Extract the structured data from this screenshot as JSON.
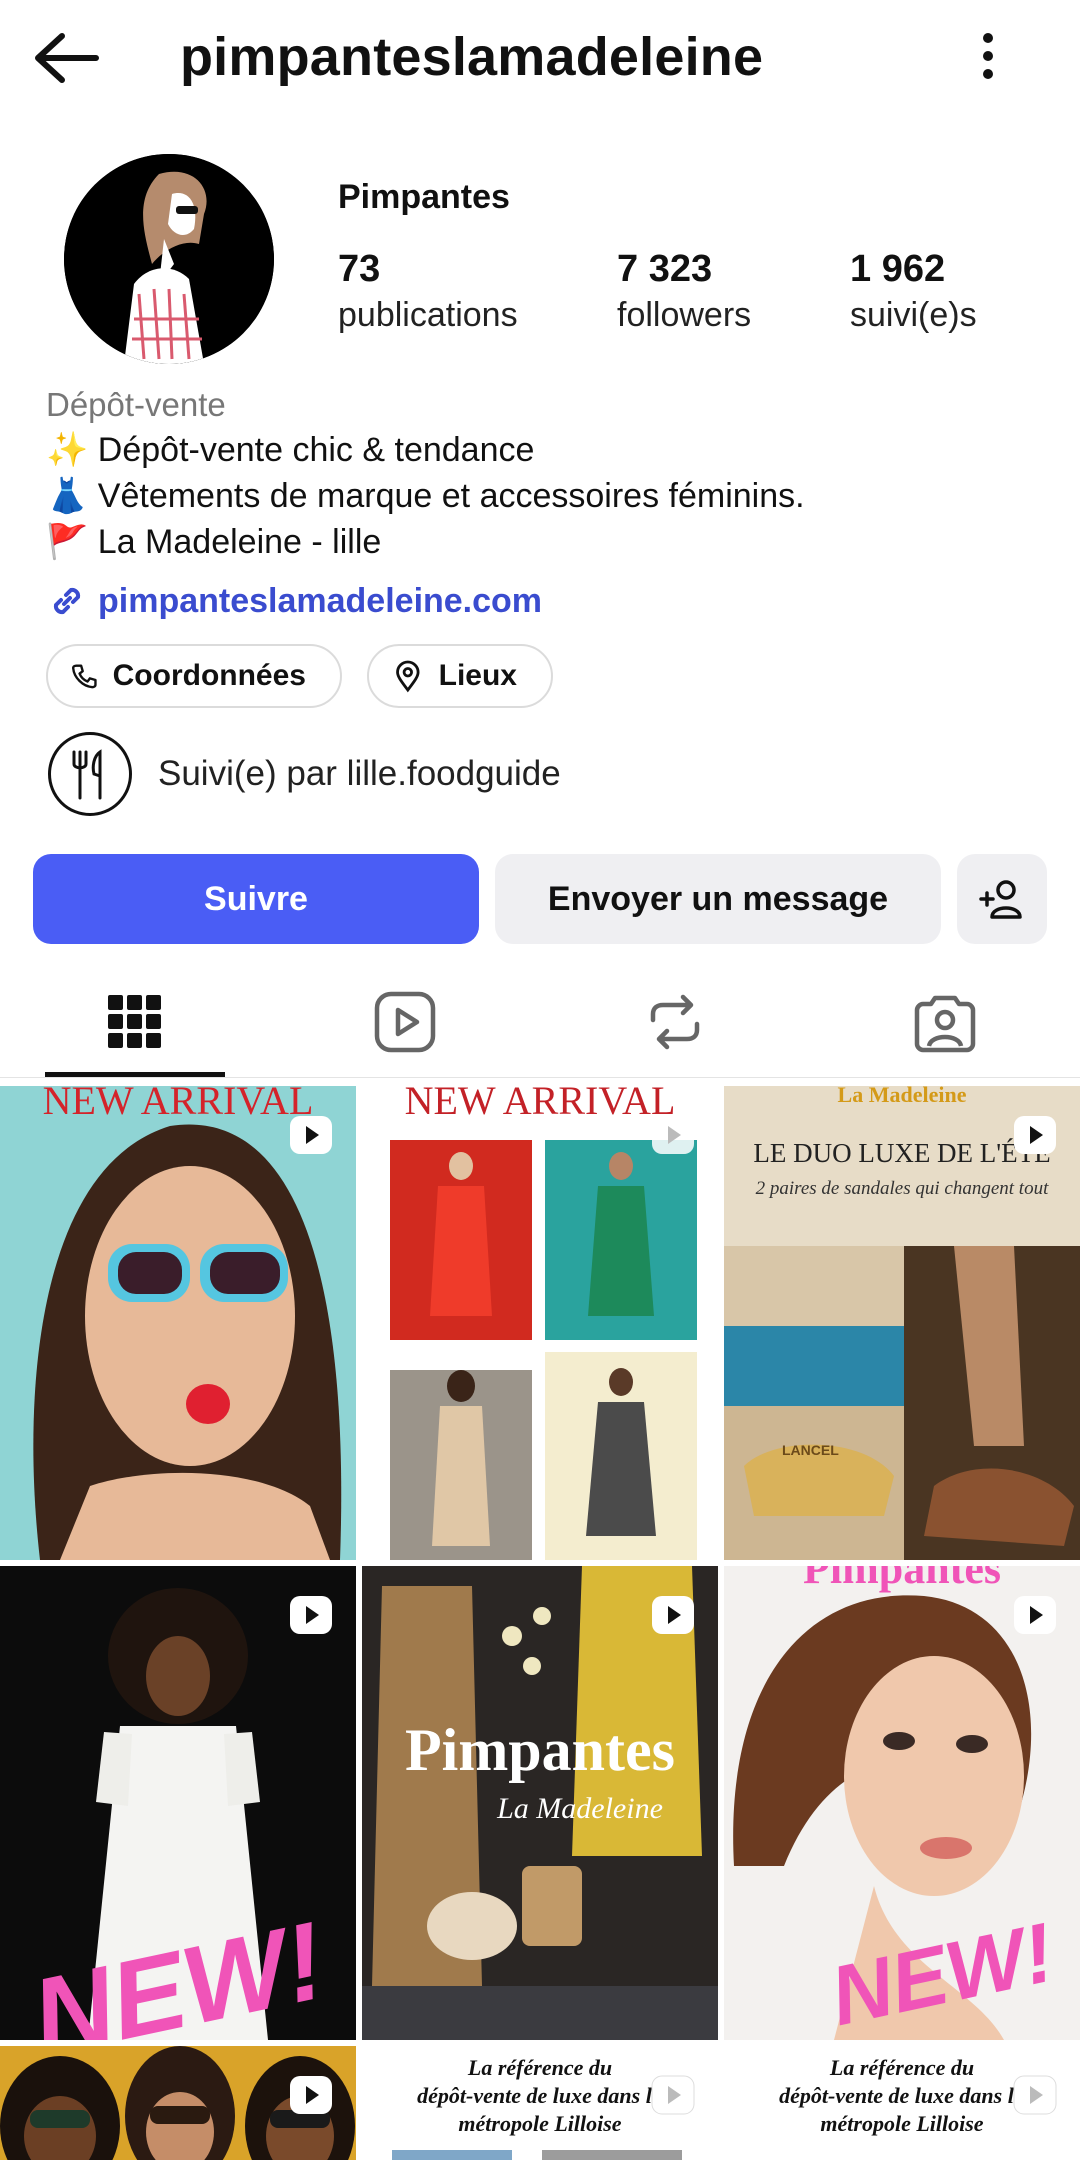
{
  "header": {
    "username": "pimpanteslamadeleine",
    "back_icon": "arrow-left-icon",
    "more_icon": "more-vertical-icon"
  },
  "profile": {
    "display_name": "Pimpantes",
    "stats": [
      {
        "value": "73",
        "label": "publications"
      },
      {
        "value": "7 323",
        "label": "followers"
      },
      {
        "value": "1 962",
        "label": "suivi(e)s"
      }
    ],
    "category": "Dépôt-vente",
    "bio": [
      {
        "emoji": "✨",
        "text": "Dépôt-vente chic & tendance"
      },
      {
        "emoji": "👗",
        "text": "Vêtements de marque et accessoires féminins."
      },
      {
        "emoji": "🚩",
        "text": " La Madeleine - lille"
      }
    ],
    "link": "pimpanteslamadeleine.com",
    "chips": [
      {
        "label": "Coordonnées",
        "icon": "phone-icon"
      },
      {
        "label": "Lieux",
        "icon": "location-pin-icon"
      }
    ],
    "followed_by": "Suivi(e) par lille.foodguide"
  },
  "actions": {
    "follow": "Suivre",
    "message": "Envoyer un message",
    "add_person_icon": "add-person-icon"
  },
  "tabs": [
    {
      "icon": "grid-icon",
      "active": true
    },
    {
      "icon": "reels-icon",
      "active": false
    },
    {
      "icon": "repost-icon",
      "active": false
    },
    {
      "icon": "tagged-icon",
      "active": false
    }
  ],
  "grid": {
    "posts": [
      {
        "overlay": "NEW ARRIVAL",
        "reel": true
      },
      {
        "overlay": "NEW ARRIVAL",
        "reel": true
      },
      {
        "overlay_top": "La Madeleine",
        "headline": "LE DUO LUXE DE L'ÉTÉ",
        "sub": "2 paires de sandales qui changent tout",
        "brand": "LANCEL",
        "reel": true
      },
      {
        "overlay": "NEW!",
        "reel": true
      },
      {
        "title": "Pimpantes",
        "subtitle": "La Madeleine",
        "reel": true
      },
      {
        "overlay_top": "Pimpantes",
        "overlay": "NEW!",
        "reel": true
      },
      {
        "reel": true
      },
      {
        "text_lines": [
          "La référence du",
          "dépôt-vente de luxe dans la",
          "métropole Lilloise"
        ],
        "reel": true
      },
      {
        "text_lines": [
          "La référence du",
          "dépôt-vente de luxe dans la",
          "métropole Lilloise"
        ],
        "reel": true
      }
    ]
  },
  "colors": {
    "accent": "#4a5df5",
    "link": "#3a4ccf",
    "muted": "#777777",
    "pink": "#f054b8"
  }
}
